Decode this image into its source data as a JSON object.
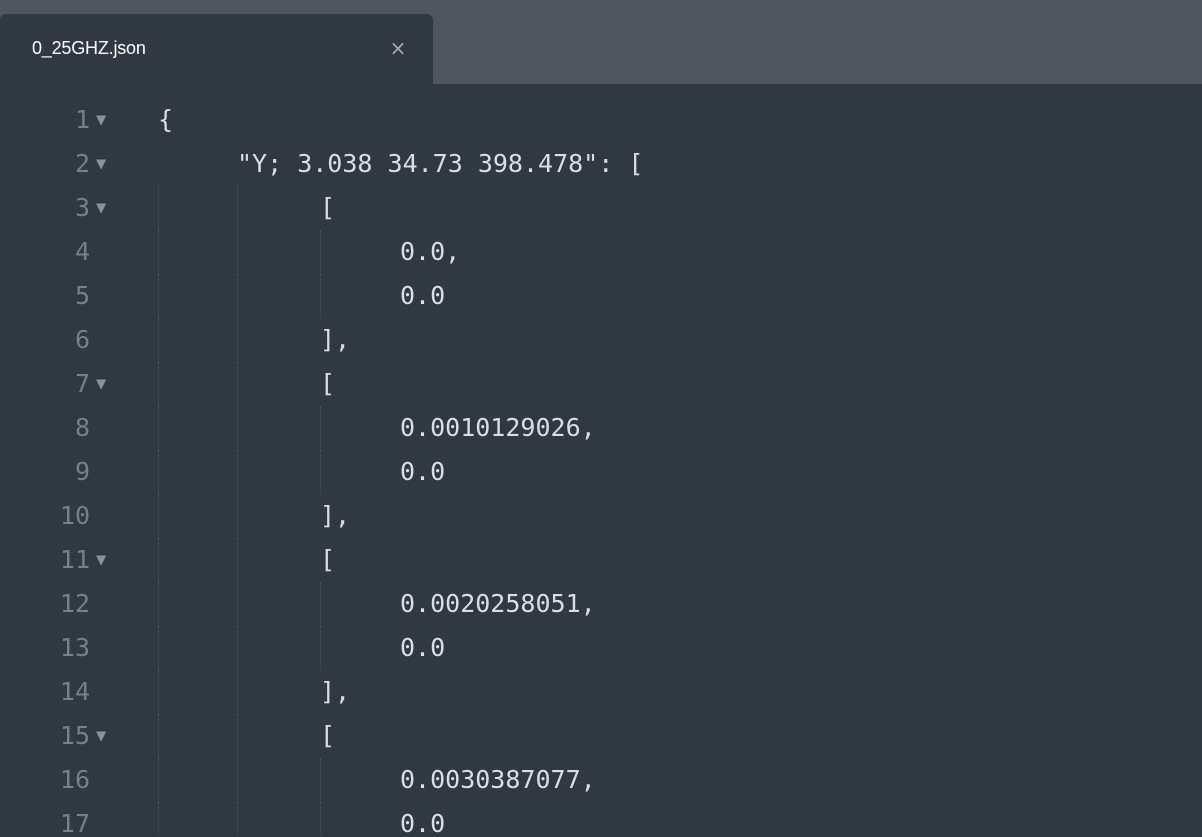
{
  "tab": {
    "title": "0_25GHZ.json",
    "close_glyph": "×"
  },
  "lines": [
    {
      "num": "1",
      "fold": "▼",
      "code": "{"
    },
    {
      "num": "2",
      "fold": "▼",
      "code": "\"Y; 3.038 34.73 398.478\": ["
    },
    {
      "num": "3",
      "fold": "▼",
      "code": "["
    },
    {
      "num": "4",
      "fold": "",
      "code": "0.0,"
    },
    {
      "num": "5",
      "fold": "",
      "code": "0.0"
    },
    {
      "num": "6",
      "fold": "",
      "code": "],"
    },
    {
      "num": "7",
      "fold": "▼",
      "code": "["
    },
    {
      "num": "8",
      "fold": "",
      "code": "0.0010129026,"
    },
    {
      "num": "9",
      "fold": "",
      "code": "0.0"
    },
    {
      "num": "10",
      "fold": "",
      "code": "],"
    },
    {
      "num": "11",
      "fold": "▼",
      "code": "["
    },
    {
      "num": "12",
      "fold": "",
      "code": "0.0020258051,"
    },
    {
      "num": "13",
      "fold": "",
      "code": "0.0"
    },
    {
      "num": "14",
      "fold": "",
      "code": "],"
    },
    {
      "num": "15",
      "fold": "▼",
      "code": "["
    },
    {
      "num": "16",
      "fold": "",
      "code": "0.0030387077,"
    },
    {
      "num": "17",
      "fold": "",
      "code": "0.0"
    }
  ],
  "colors": {
    "background": "#303841",
    "tabbar": "#4f565e",
    "text": "#d8dee9",
    "gutter": "#75808b"
  }
}
